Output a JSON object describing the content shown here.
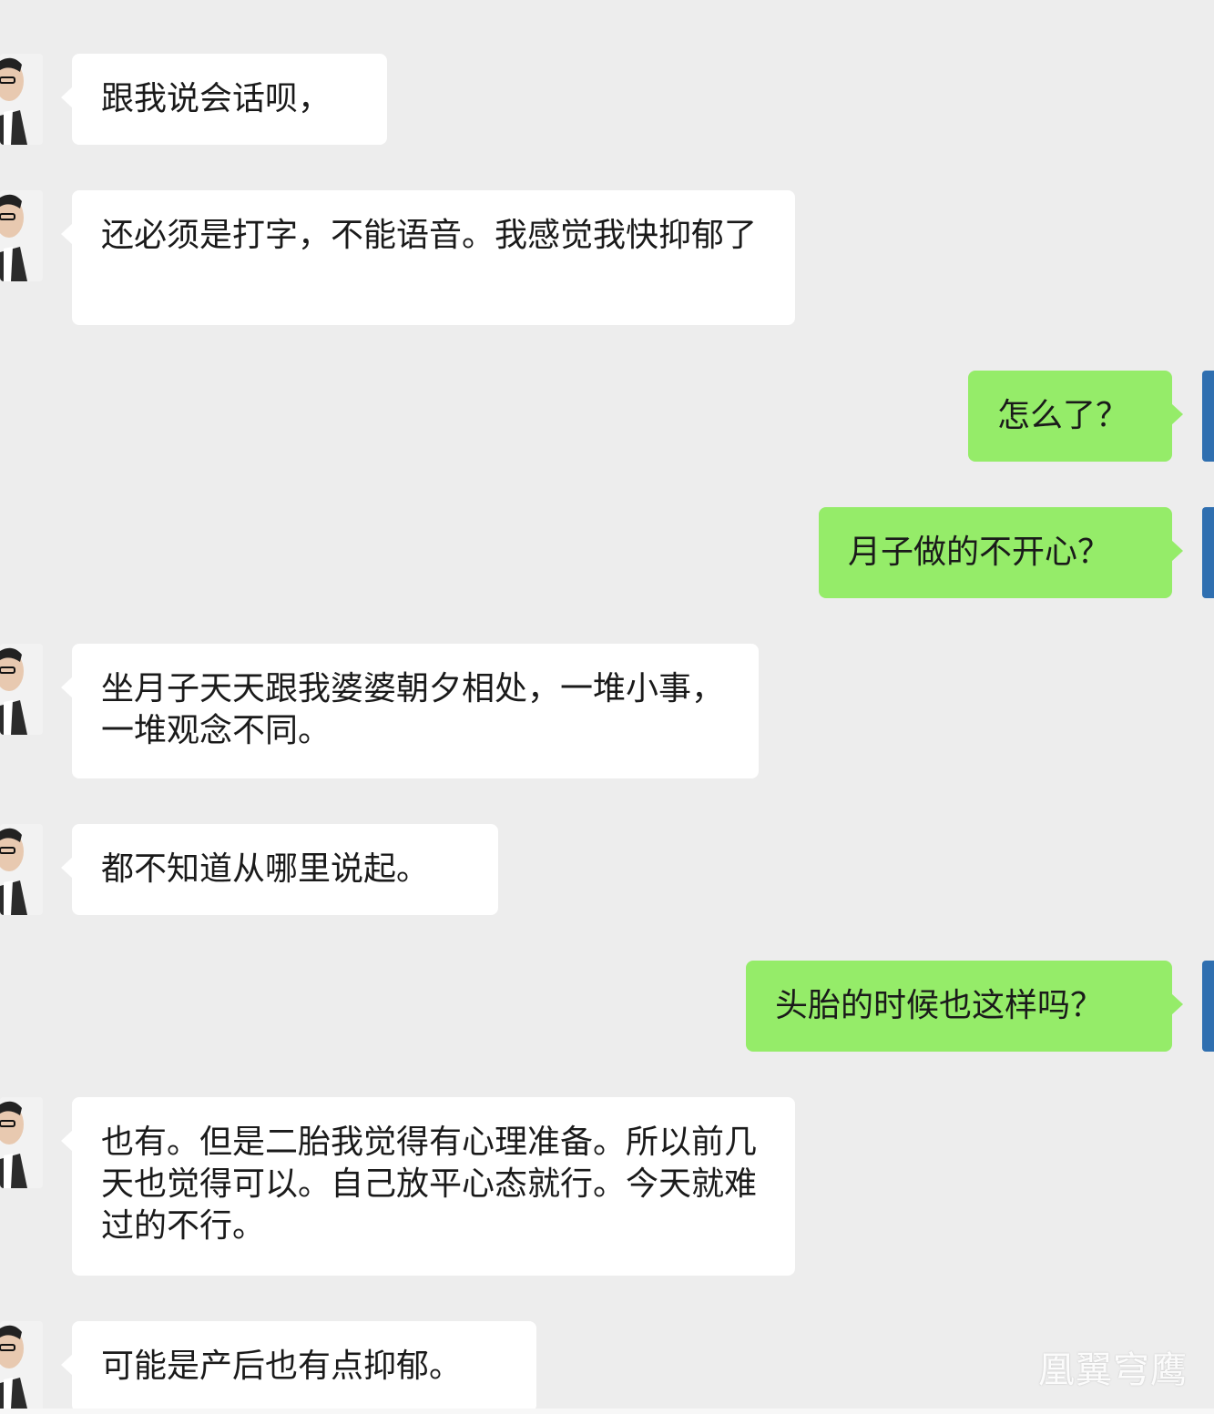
{
  "messages": [
    {
      "side": "left",
      "text": "跟我说会话呗，"
    },
    {
      "side": "left",
      "text": "还必须是打字，不能语音。我感觉我快抑郁了"
    },
    {
      "side": "right",
      "text": "怎么了？"
    },
    {
      "side": "right",
      "text": "月子做的不开心？"
    },
    {
      "side": "left",
      "text": "坐月子天天跟我婆婆朝夕相处，一堆小事，一堆观念不同。"
    },
    {
      "side": "left",
      "text": "都不知道从哪里说起。"
    },
    {
      "side": "right",
      "text": "头胎的时候也这样吗？"
    },
    {
      "side": "left",
      "text": "也有。但是二胎我觉得有心理准备。所以前几天也觉得可以。自己放平心态就行。今天就难过的不行。"
    },
    {
      "side": "left",
      "text": "可能是产后也有点抑郁。"
    }
  ],
  "watermark": "凰翼穹鹰",
  "colors": {
    "background": "#ededed",
    "incoming_bubble": "#ffffff",
    "outgoing_bubble": "#95ec69"
  }
}
